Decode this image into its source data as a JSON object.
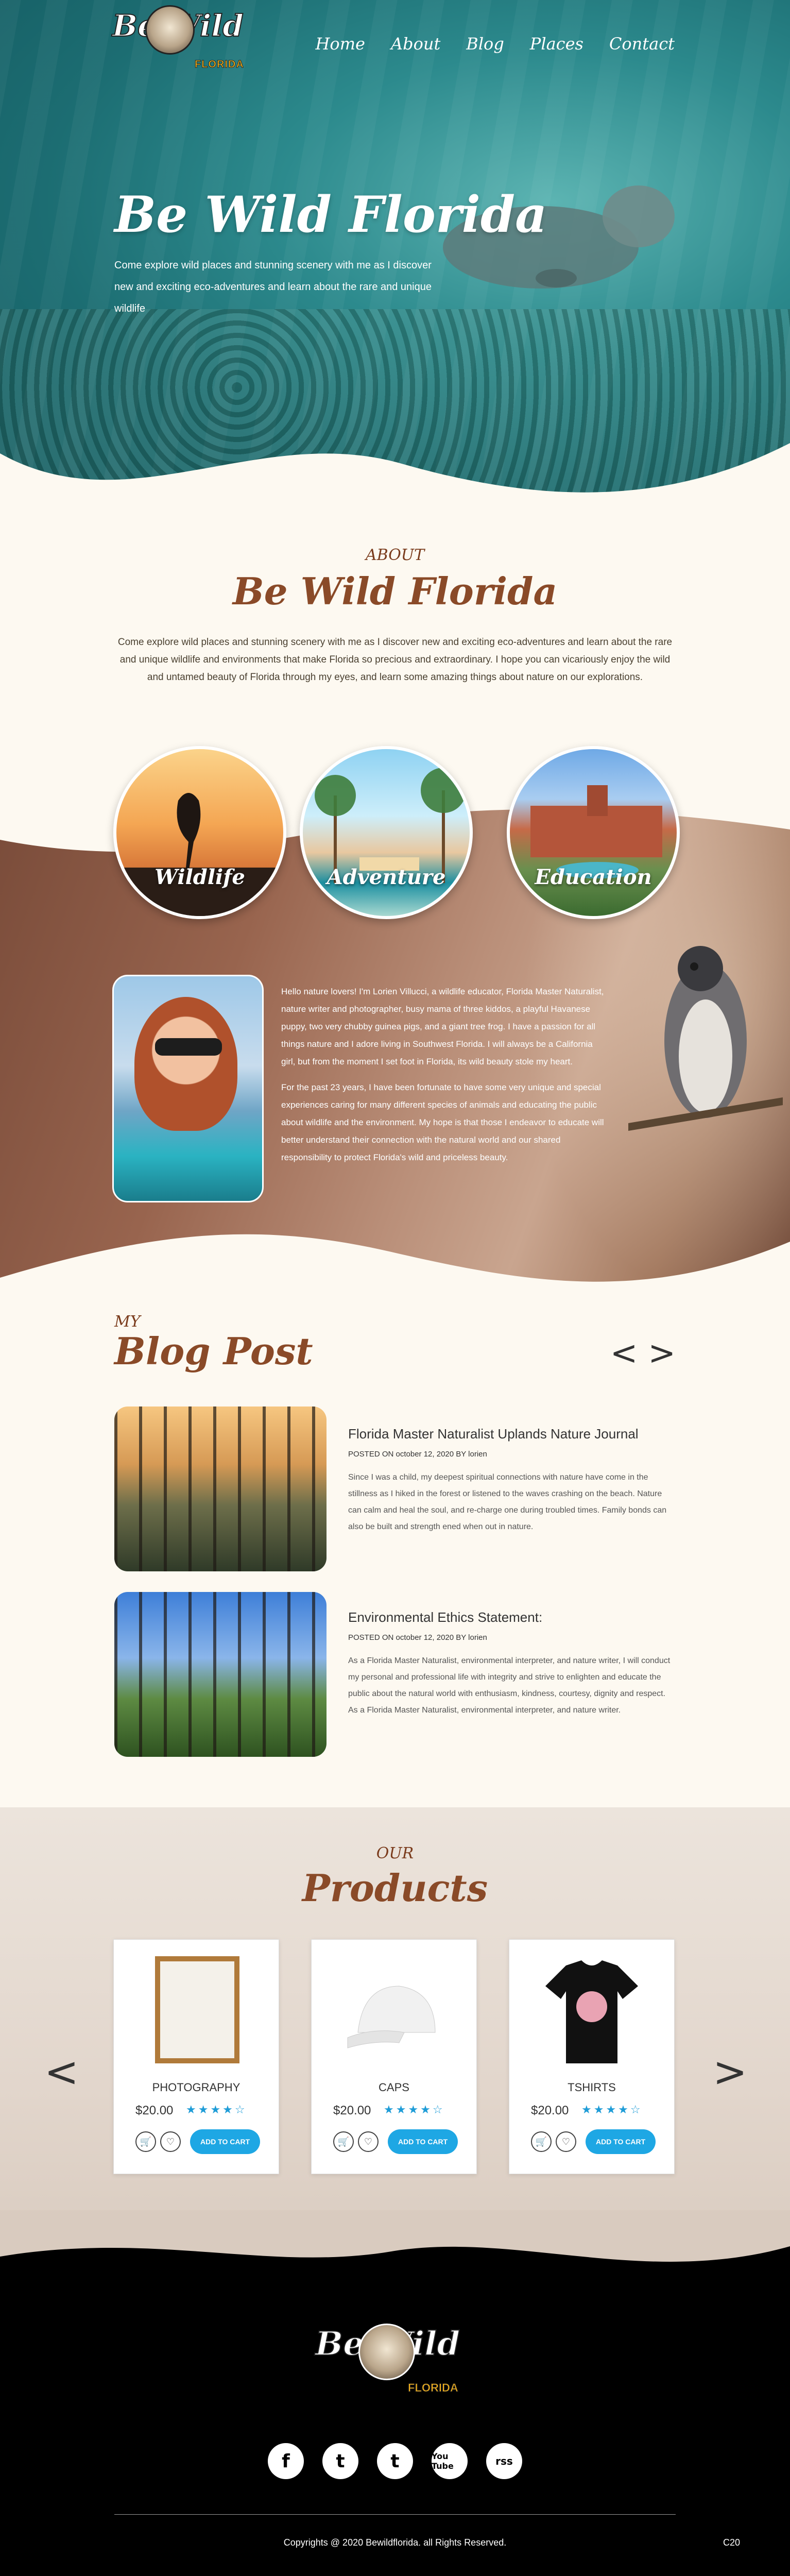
{
  "brand": {
    "logo_word": "Be Wild",
    "logo_sub": "FLORIDA"
  },
  "nav": [
    "Home",
    "About",
    "Blog",
    "Places",
    "Contact"
  ],
  "hero": {
    "title": "Be Wild Florida",
    "text": "Come explore wild places and stunning scenery with me as I discover new and exciting eco-adventures and learn about the rare and unique wildlife"
  },
  "about": {
    "eyebrow": "ABOUT",
    "title": "Be Wild Florida",
    "text": "Come explore wild places and stunning scenery with me as I discover new and exciting eco-adventures and learn about the rare and unique wildlife and environments that make Florida so precious and extraordinary. I hope you can vicariously enjoy the wild and untamed beauty of Florida through my eyes, and learn some amazing things about nature on our explorations.",
    "categories": [
      "Wildlife",
      "Adventure",
      "Education"
    ],
    "bio": [
      "Hello nature lovers! I'm Lorien Villucci, a wildlife educator, Florida Master Naturalist, nature writer and photographer, busy mama of three kiddos, a playful Havanese puppy, two very chubby guinea pigs, and a giant tree frog. I have a passion for all things nature and I adore living in Southwest Florida. I will always be a California girl, but from the moment I set foot in Florida, its wild beauty stole my heart.",
      "For the past 23 years, I have been fortunate to have some very unique and special experiences caring for many different species of animals and educating the public about wildlife and the environment. My hope is that those I endeavor to educate will better understand their connection with the natural world and our shared responsibility to protect Florida's wild and priceless beauty."
    ]
  },
  "blog": {
    "eyebrow": "MY",
    "title": "Blog Post",
    "prev": "<",
    "next": ">",
    "posts": [
      {
        "title": "Florida Master Naturalist Uplands Nature Journal",
        "meta": "POSTED ON october 12, 2020  BY  lorien",
        "body": "Since I was a child, my deepest spiritual connections with nature have come in the stillness as I hiked in the forest or listened to the waves crashing on the beach. Nature can calm and heal the soul, and re-charge one during troubled times. Family bonds can also be built and strength ened when out in nature."
      },
      {
        "title": "Environmental Ethics Statement:",
        "meta": "POSTED ON october 12, 2020  BY  lorien",
        "body": "As a Florida Master Naturalist, environmental interpreter, and nature writer, I will conduct my personal and professional life with integrity and strive to enlighten and educate the public about the natural world with enthusiasm, kindness, courtesy, dignity and respect. As a Florida Master Naturalist, environmental interpreter, and nature writer."
      }
    ]
  },
  "products": {
    "eyebrow": "OUR",
    "title": "Products",
    "prev": "<",
    "next": ">",
    "items": [
      {
        "name": "PHOTOGRAPHY",
        "price": "$20.00",
        "stars": "★★★★☆",
        "rating": 4,
        "cta": "ADD TO CART"
      },
      {
        "name": "CAPS",
        "price": "$20.00",
        "stars": "★★★★☆",
        "rating": 4,
        "cta": "ADD TO CART"
      },
      {
        "name": "TSHIRTS",
        "price": "$20.00",
        "stars": "★★★★☆",
        "rating": 4,
        "cta": "ADD TO CART"
      }
    ]
  },
  "footer": {
    "social": [
      "f",
      "t",
      "t",
      "You Tube",
      "rss"
    ],
    "copyright": "Copyrights @ 2020 Bewildflorida. all Rights Reserved.",
    "code": "C20"
  },
  "colors": {
    "accent": "#1ea7e4",
    "title_brown": "#8a4a28",
    "teal": "#2c8a8d"
  }
}
